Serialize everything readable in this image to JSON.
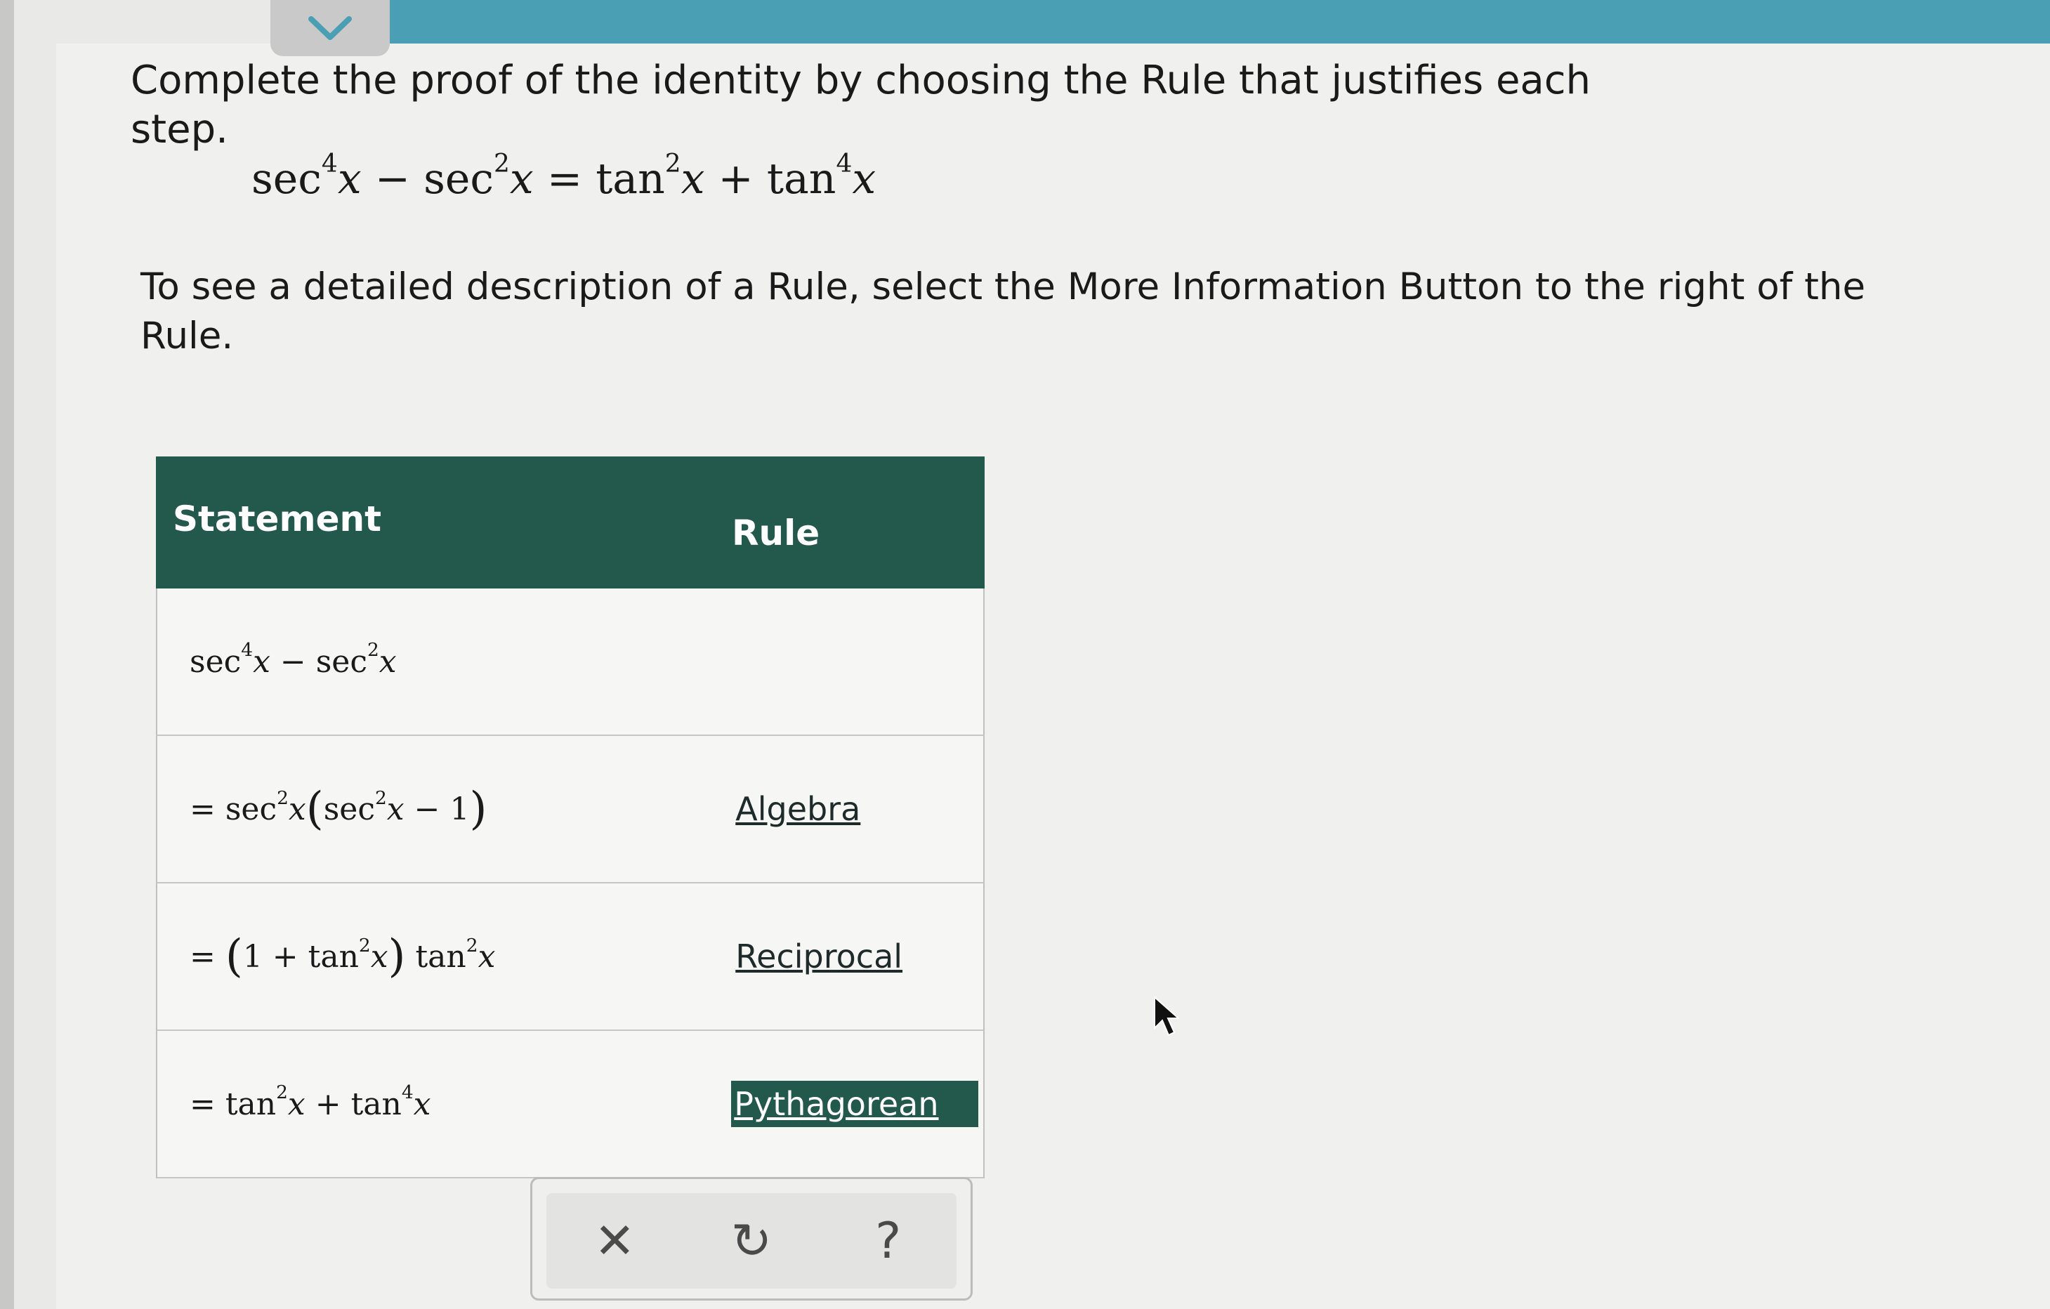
{
  "instruction": "Complete the proof of the identity by choosing the Rule that justifies each step.",
  "identity": {
    "lhs_1": "sec",
    "lhs_1_exp": "4",
    "lhs_1_var": "x",
    "minus": "−",
    "lhs_2": "sec",
    "lhs_2_exp": "2",
    "lhs_2_var": "x",
    "equals": "=",
    "rhs_1": "tan",
    "rhs_1_exp": "2",
    "rhs_1_var": "x",
    "plus": "+",
    "rhs_2": "tan",
    "rhs_2_exp": "4",
    "rhs_2_var": "x"
  },
  "info": "To see a detailed description of a Rule, select the More Information Button to the right of the Rule.",
  "table": {
    "header_statement": "Statement",
    "header_rule": "Rule",
    "rows": [
      {
        "rule": ""
      },
      {
        "rule": "Algebra"
      },
      {
        "rule": "Reciprocal"
      },
      {
        "rule": "Pythagorean"
      }
    ]
  },
  "actions": {
    "clear": "✕",
    "undo": "↻",
    "help": "?"
  },
  "colors": {
    "header_bg": "#23584d",
    "top_bar": "#4a9fb4",
    "selected_rule_bg": "#23584d"
  }
}
